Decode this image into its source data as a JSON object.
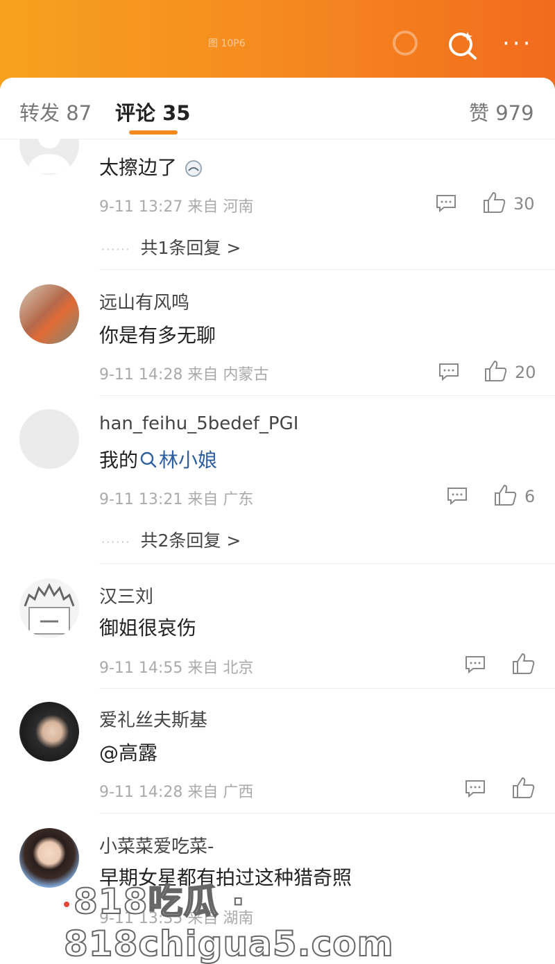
{
  "header": {
    "blurred_title": "图 10P6",
    "more_label": "···"
  },
  "tabs": {
    "repost": "转发 87",
    "comments": "评论 35",
    "likes": "赞 979"
  },
  "comments": [
    {
      "user": "",
      "text": "太擦边了",
      "time": "9-11 13:27",
      "from": "来自",
      "location": "河南",
      "likes": "30",
      "replies": "共1条回复 >"
    },
    {
      "user": "远山有风鸣",
      "text": "你是有多无聊",
      "time": "9-11 14:28",
      "from": "来自",
      "location": "内蒙古",
      "likes": "20"
    },
    {
      "user": "han_feihu_5bedef_PGI",
      "text_prefix": "我的",
      "text_link": "林小娘",
      "time": "9-11 13:21",
      "from": "来自",
      "location": "广东",
      "likes": "6",
      "replies": "共2条回复 >"
    },
    {
      "user": "汉三刘",
      "text": "御姐很哀伤",
      "time": "9-11 14:55",
      "from": "来自",
      "location": "北京",
      "likes": ""
    },
    {
      "user": "爱礼丝夫斯基",
      "text": "@高露",
      "time": "9-11 14:28",
      "from": "来自",
      "location": "广西",
      "likes": ""
    },
    {
      "user": "小菜菜爱吃菜-",
      "text": "早期女星都有拍过这种猎奇照",
      "time": "9-11 13:35",
      "from": "来自",
      "location": "湖南"
    }
  ],
  "watermark": "818吃瓜 · 818chigua5.com",
  "colors": {
    "accent": "#f58a1f",
    "brand_gradient_start": "#f7a11f",
    "brand_gradient_end": "#f26b1e"
  }
}
